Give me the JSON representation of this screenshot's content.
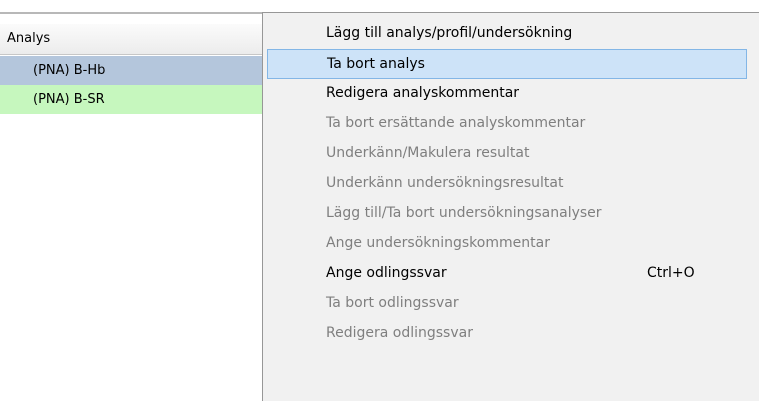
{
  "grid": {
    "header": "Analys",
    "rows": [
      {
        "label": "(PNA) B-Hb",
        "bg": "#b4c6dc"
      },
      {
        "label": "(PNA) B-SR",
        "bg": "#c6f7be"
      }
    ]
  },
  "menu": {
    "highlight_color": "#cde3f8",
    "items": [
      {
        "label": "Lägg till analys/profil/undersökning",
        "enabled": true,
        "highlighted": false
      },
      {
        "label": "Ta bort analys",
        "enabled": true,
        "highlighted": true
      },
      {
        "label": "Redigera analyskommentar",
        "enabled": true,
        "highlighted": false
      },
      {
        "label": "Ta bort ersättande analyskommentar",
        "enabled": false,
        "highlighted": false
      },
      {
        "label": "Underkänn/Makulera resultat",
        "enabled": false,
        "highlighted": false
      },
      {
        "label": "Underkänn undersökningsresultat",
        "enabled": false,
        "highlighted": false
      },
      {
        "label": "Lägg till/Ta bort undersökningsanalyser",
        "enabled": false,
        "highlighted": false
      },
      {
        "label": "Ange undersökningskommentar",
        "enabled": false,
        "highlighted": false
      },
      {
        "label": "Ange odlingssvar",
        "shortcut": "Ctrl+O",
        "enabled": true,
        "highlighted": false
      },
      {
        "label": "Ta bort odlingssvar",
        "enabled": false,
        "highlighted": false
      },
      {
        "label": "Redigera odlingssvar",
        "enabled": false,
        "highlighted": false
      }
    ]
  }
}
